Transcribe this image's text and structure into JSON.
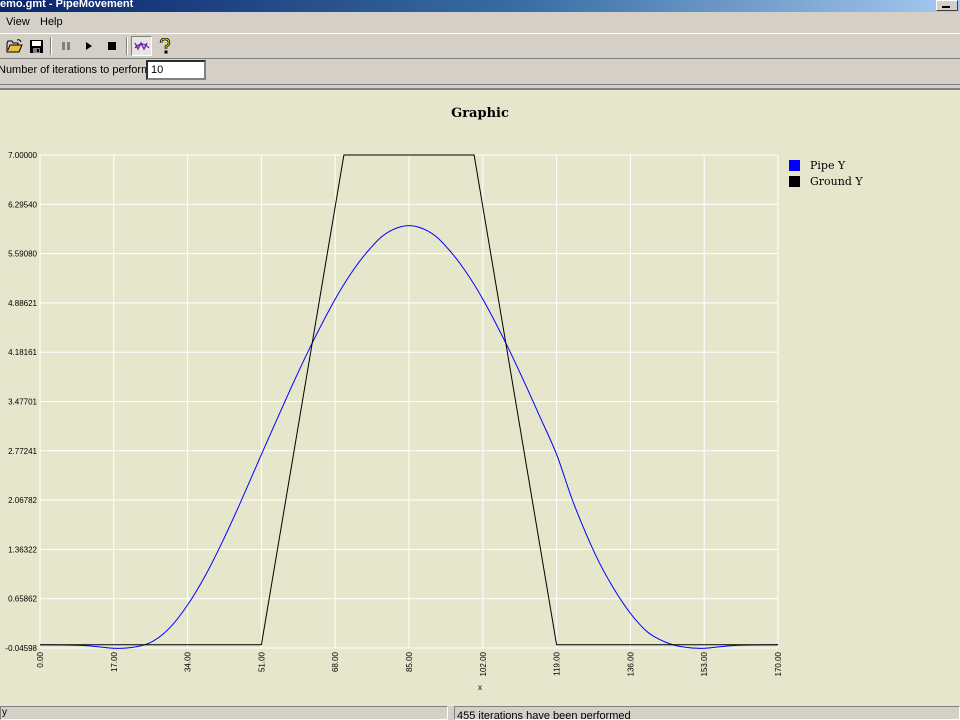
{
  "window": {
    "title": "emo.gmt - PipeMovement"
  },
  "menu": {
    "items": [
      "View",
      "Help"
    ]
  },
  "toolbar": {
    "buttons": [
      "open-folder-icon",
      "save-disk-icon",
      "pause-icon",
      "play-icon",
      "stop-icon",
      "graph-icon",
      "help-icon"
    ],
    "pressed": "graph-icon"
  },
  "iterations": {
    "label": "Number of iterations to perform",
    "value": "10"
  },
  "chart": {
    "title": "Graphic",
    "legend": [
      "Pipe Y",
      "Ground Y"
    ]
  },
  "chart_data": {
    "type": "line",
    "title": "Graphic",
    "xlabel": "x",
    "ylabel": "",
    "xlim": [
      0,
      170
    ],
    "ylim": [
      -0.04598,
      7.0
    ],
    "x_ticks": [
      "0.00",
      "17.00",
      "34.00",
      "51.00",
      "68.00",
      "85.00",
      "102.00",
      "119.00",
      "136.00",
      "153.00",
      "170.00"
    ],
    "y_ticks": [
      "-0.04598",
      "0.65862",
      "1.36322",
      "2.06782",
      "2.77241",
      "3.47701",
      "4.18161",
      "4.88621",
      "5.59080",
      "6.29540",
      "7.00000"
    ],
    "grid": true,
    "legend_position": "right",
    "series": [
      {
        "name": "Pipe Y",
        "color": "#0000ff",
        "x": [
          0,
          10,
          17,
          22,
          26,
          30,
          34,
          38,
          42,
          46,
          51,
          55,
          59,
          63,
          68,
          72,
          76,
          80,
          85,
          90,
          94,
          98,
          102,
          107,
          111,
          115,
          119,
          123,
          128,
          132,
          136,
          140,
          144,
          148,
          153,
          160,
          170
        ],
        "y": [
          0.0,
          -0.01,
          -0.05,
          -0.03,
          0.05,
          0.25,
          0.57,
          0.98,
          1.47,
          2.01,
          2.72,
          3.28,
          3.83,
          4.35,
          4.94,
          5.34,
          5.66,
          5.89,
          5.99,
          5.89,
          5.66,
          5.34,
          4.94,
          4.35,
          3.83,
          3.28,
          2.72,
          2.01,
          1.28,
          0.82,
          0.45,
          0.18,
          0.04,
          -0.03,
          -0.05,
          -0.01,
          0.0
        ]
      },
      {
        "name": "Ground Y",
        "color": "#000000",
        "x": [
          0,
          50,
          51,
          70,
          100,
          119,
          120,
          170
        ],
        "y": [
          0.0,
          0.0,
          0.0,
          7.0,
          7.0,
          0.0,
          0.0,
          0.0
        ]
      }
    ]
  },
  "status": {
    "left": "y",
    "right": "455 iterations have been performed"
  }
}
